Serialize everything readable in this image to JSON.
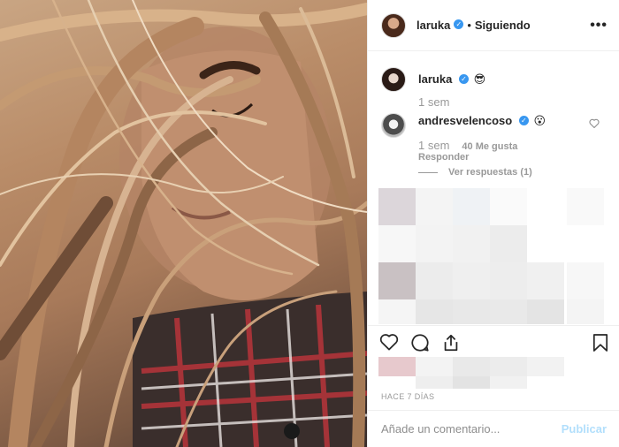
{
  "post": {
    "username": "laruka",
    "follow_status": "Siguiendo",
    "separator": "•",
    "more_icon": "ellipsis-icon"
  },
  "comments": [
    {
      "username": "laruka",
      "emoji": "😎",
      "time": "1 sem"
    },
    {
      "username": "andresvelencoso",
      "emoji": "😮",
      "time": "1 sem",
      "likes": "40 Me gusta",
      "reply": "Responder",
      "view_replies": "Ver respuestas (1)"
    }
  ],
  "actions": {
    "like": "heart-icon",
    "comment": "comment-icon",
    "share": "share-icon",
    "save": "bookmark-icon"
  },
  "date": "HACE 7 DÍAS",
  "add_comment": {
    "placeholder": "Añade un comentario...",
    "publish": "Publicar"
  },
  "colors": {
    "verified": "#3897f0",
    "muted": "#999999",
    "publish_disabled": "#b2dffc"
  }
}
